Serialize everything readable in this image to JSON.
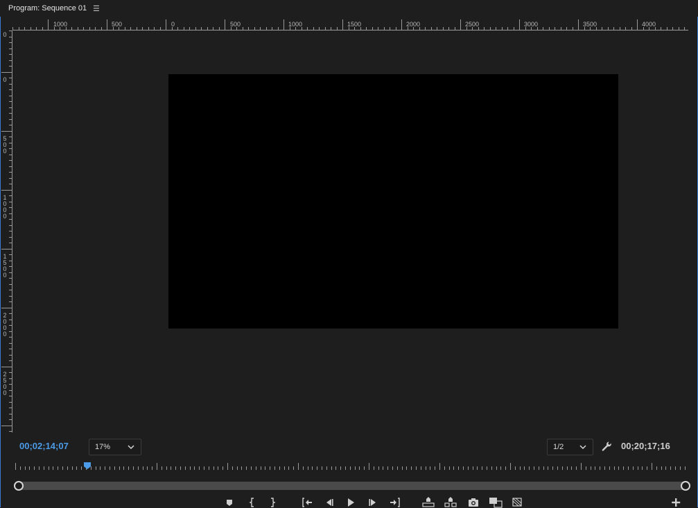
{
  "panel": {
    "title": "Program: Sequence 01",
    "menu_icon": "hamburger-menu-icon",
    "accent_color": "#3a7bd5"
  },
  "rulers": {
    "horizontal_labels": [
      "1000",
      "500",
      "0",
      "500",
      "1000",
      "1500",
      "2000",
      "2500",
      "3000",
      "3500",
      "4000"
    ],
    "vertical_labels": [
      "0",
      "0",
      "500",
      "1000",
      "1500",
      "2000",
      "2500"
    ]
  },
  "playback": {
    "current_timecode": "00;02;14;07",
    "duration_timecode": "00;20;17;16",
    "zoom_level": "17%",
    "resolution": "1/2",
    "playhead_position_fraction": 0.111,
    "current_timecode_color": "#4b9be8"
  },
  "controls": {
    "buttons": [
      {
        "name": "add-marker-button",
        "icon": "marker-icon"
      },
      {
        "name": "mark-in-button",
        "icon": "mark-in-icon"
      },
      {
        "name": "mark-out-button",
        "icon": "mark-out-icon"
      },
      {
        "name": "go-to-in-button",
        "icon": "go-to-in-icon"
      },
      {
        "name": "step-back-button",
        "icon": "step-back-icon"
      },
      {
        "name": "play-button",
        "icon": "play-icon"
      },
      {
        "name": "step-forward-button",
        "icon": "step-forward-icon"
      },
      {
        "name": "go-to-out-button",
        "icon": "go-to-out-icon"
      },
      {
        "name": "lift-button",
        "icon": "lift-icon"
      },
      {
        "name": "extract-button",
        "icon": "extract-icon"
      },
      {
        "name": "export-frame-button",
        "icon": "camera-icon"
      },
      {
        "name": "comparison-view-button",
        "icon": "comparison-view-icon"
      },
      {
        "name": "proxy-toggle-button",
        "icon": "proxy-icon"
      },
      {
        "name": "button-editor-button",
        "icon": "plus-icon"
      }
    ]
  }
}
